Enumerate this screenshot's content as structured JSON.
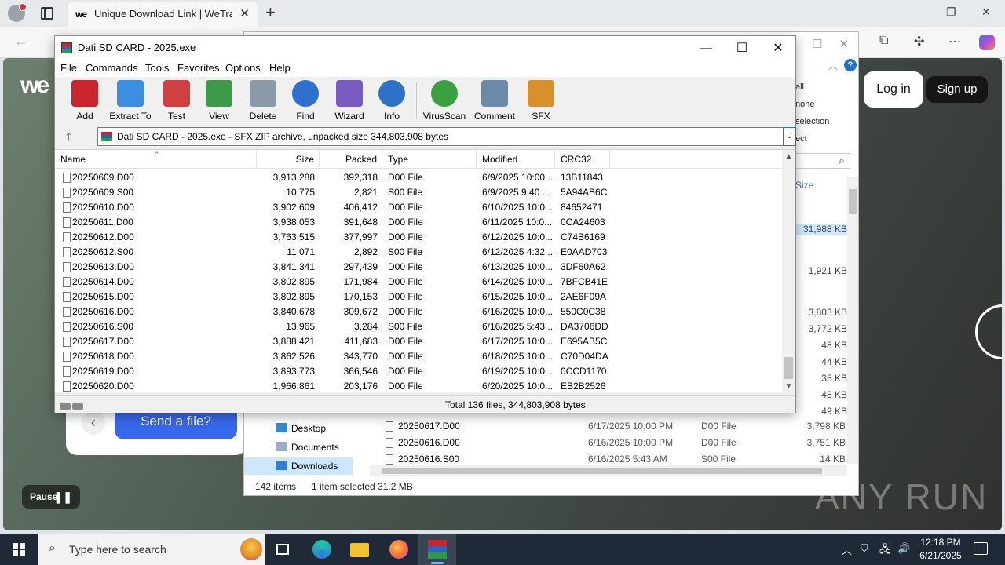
{
  "browser": {
    "tab_title": "Unique Download Link | WeTransf",
    "tab_favicon_text": "we",
    "toolbar_icons": [
      "back-icon",
      "favorites-icon",
      "extensions-icon",
      "more-icon",
      "copilot-icon"
    ]
  },
  "wetransfer": {
    "logo": "we",
    "login_label": "Log in",
    "signup_label": "Sign up",
    "send_label": "Send a file?",
    "pause_label": "Pause"
  },
  "explorer": {
    "ribbon_items": [
      "all",
      "none",
      "selection",
      "ect"
    ],
    "size_header": "Size",
    "size_values": [
      "31,988 KB",
      "1,921 KB",
      "3,803 KB",
      "3,772 KB",
      "48 KB",
      "44 KB",
      "35 KB",
      "48 KB",
      "49 KB",
      "3,798 KB",
      "3,751 KB",
      "14 KB"
    ],
    "nav_items": [
      {
        "label": "Desktop"
      },
      {
        "label": "Documents"
      },
      {
        "label": "Downloads"
      }
    ],
    "rows": [
      {
        "name": "20250617.D00",
        "date": "6/17/2025 10:00 PM",
        "type": "D00 File",
        "size": "3,798 KB"
      },
      {
        "name": "20250616.D00",
        "date": "6/16/2025 10:00 PM",
        "type": "D00 File",
        "size": "3,751 KB"
      },
      {
        "name": "20250616.S00",
        "date": "6/16/2025 5:43 AM",
        "type": "S00 File",
        "size": "14 KB"
      }
    ],
    "status_items": "142 items",
    "status_selected": "1 item selected  31.2 MB"
  },
  "winrar": {
    "title": "Dati SD CARD - 2025.exe",
    "menu": [
      "File",
      "Commands",
      "Tools",
      "Favorites",
      "Options",
      "Help"
    ],
    "toolbar": [
      {
        "label": "Add",
        "icon": "add-archive-icon",
        "color": "#c8262c"
      },
      {
        "label": "Extract To",
        "icon": "extract-folder-icon",
        "color": "#3b8ee0"
      },
      {
        "label": "Test",
        "icon": "test-clipboard-icon",
        "color": "#d04040"
      },
      {
        "label": "View",
        "icon": "view-book-icon",
        "color": "#3e9a4a"
      },
      {
        "label": "Delete",
        "icon": "delete-trash-icon",
        "color": "#8a9aa8"
      },
      {
        "label": "Find",
        "icon": "find-magnifier-icon",
        "color": "#2e6fd0"
      },
      {
        "label": "Wizard",
        "icon": "wizard-wand-icon",
        "color": "#7a5cc0"
      },
      {
        "label": "Info",
        "icon": "info-icon",
        "color": "#2e72c8"
      },
      {
        "label": "VirusScan",
        "icon": "virus-scan-icon",
        "color": "#3aa040"
      },
      {
        "label": "Comment",
        "icon": "comment-icon",
        "color": "#6b8aa8"
      },
      {
        "label": "SFX",
        "icon": "sfx-box-icon",
        "color": "#d8902a"
      }
    ],
    "address": "Dati SD CARD - 2025.exe - SFX ZIP archive, unpacked size 344,803,908 bytes",
    "columns": [
      "Name",
      "Size",
      "Packed",
      "Type",
      "Modified",
      "CRC32"
    ],
    "files": [
      {
        "name": "20250609.D00",
        "size": "3,913,288",
        "packed": "392,318",
        "type": "D00 File",
        "modified": "6/9/2025 10:00 ...",
        "crc": "13B11843"
      },
      {
        "name": "20250609.S00",
        "size": "10,775",
        "packed": "2,821",
        "type": "S00 File",
        "modified": "6/9/2025 9:40 ...",
        "crc": "5A94AB6C"
      },
      {
        "name": "20250610.D00",
        "size": "3,902,609",
        "packed": "406,412",
        "type": "D00 File",
        "modified": "6/10/2025 10:0...",
        "crc": "84652471"
      },
      {
        "name": "20250611.D00",
        "size": "3,938,053",
        "packed": "391,648",
        "type": "D00 File",
        "modified": "6/11/2025 10:0...",
        "crc": "0CA24603"
      },
      {
        "name": "20250612.D00",
        "size": "3,763,515",
        "packed": "377,997",
        "type": "D00 File",
        "modified": "6/12/2025 10:0...",
        "crc": "C74B6169"
      },
      {
        "name": "20250612.S00",
        "size": "11,071",
        "packed": "2,892",
        "type": "S00 File",
        "modified": "6/12/2025 4:32 ...",
        "crc": "E0AAD703"
      },
      {
        "name": "20250613.D00",
        "size": "3,841,341",
        "packed": "297,439",
        "type": "D00 File",
        "modified": "6/13/2025 10:0...",
        "crc": "3DF60A62"
      },
      {
        "name": "20250614.D00",
        "size": "3,802,895",
        "packed": "171,984",
        "type": "D00 File",
        "modified": "6/14/2025 10:0...",
        "crc": "7BFCB41E"
      },
      {
        "name": "20250615.D00",
        "size": "3,802,895",
        "packed": "170,153",
        "type": "D00 File",
        "modified": "6/15/2025 10:0...",
        "crc": "2AE6F09A"
      },
      {
        "name": "20250616.D00",
        "size": "3,840,678",
        "packed": "309,672",
        "type": "D00 File",
        "modified": "6/16/2025 10:0...",
        "crc": "550C0C38"
      },
      {
        "name": "20250616.S00",
        "size": "13,965",
        "packed": "3,284",
        "type": "S00 File",
        "modified": "6/16/2025 5:43 ...",
        "crc": "DA3706DD"
      },
      {
        "name": "20250617.D00",
        "size": "3,888,421",
        "packed": "411,683",
        "type": "D00 File",
        "modified": "6/17/2025 10:0...",
        "crc": "E695AB5C"
      },
      {
        "name": "20250618.D00",
        "size": "3,862,526",
        "packed": "343,770",
        "type": "D00 File",
        "modified": "6/18/2025 10:0...",
        "crc": "C70D04DA"
      },
      {
        "name": "20250619.D00",
        "size": "3,893,773",
        "packed": "366,546",
        "type": "D00 File",
        "modified": "6/19/2025 10:0...",
        "crc": "0CCD1170"
      },
      {
        "name": "20250620.D00",
        "size": "1,966,861",
        "packed": "203,176",
        "type": "D00 File",
        "modified": "6/20/2025 10:0...",
        "crc": "EB2B2526"
      }
    ],
    "status": "Total 136 files, 344,803,908 bytes"
  },
  "taskbar": {
    "search_placeholder": "Type here to search",
    "time": "12:18 PM",
    "date": "6/21/2025"
  },
  "watermark": "ANY RUN"
}
